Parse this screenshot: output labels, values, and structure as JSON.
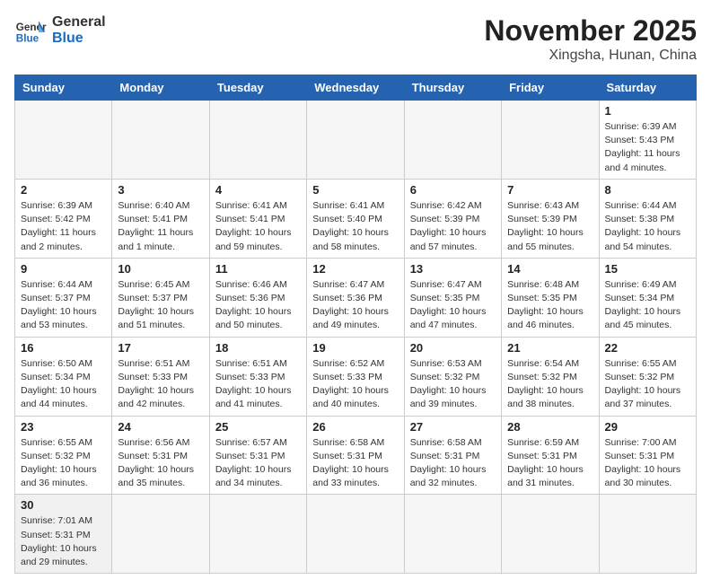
{
  "header": {
    "logo_line1": "General",
    "logo_line2": "Blue",
    "title": "November 2025",
    "subtitle": "Xingsha, Hunan, China"
  },
  "weekdays": [
    "Sunday",
    "Monday",
    "Tuesday",
    "Wednesday",
    "Thursday",
    "Friday",
    "Saturday"
  ],
  "weeks": [
    [
      {
        "day": "",
        "info": ""
      },
      {
        "day": "",
        "info": ""
      },
      {
        "day": "",
        "info": ""
      },
      {
        "day": "",
        "info": ""
      },
      {
        "day": "",
        "info": ""
      },
      {
        "day": "",
        "info": ""
      },
      {
        "day": "1",
        "info": "Sunrise: 6:39 AM\nSunset: 5:43 PM\nDaylight: 11 hours\nand 4 minutes."
      }
    ],
    [
      {
        "day": "2",
        "info": "Sunrise: 6:39 AM\nSunset: 5:42 PM\nDaylight: 11 hours\nand 2 minutes."
      },
      {
        "day": "3",
        "info": "Sunrise: 6:40 AM\nSunset: 5:41 PM\nDaylight: 11 hours\nand 1 minute."
      },
      {
        "day": "4",
        "info": "Sunrise: 6:41 AM\nSunset: 5:41 PM\nDaylight: 10 hours\nand 59 minutes."
      },
      {
        "day": "5",
        "info": "Sunrise: 6:41 AM\nSunset: 5:40 PM\nDaylight: 10 hours\nand 58 minutes."
      },
      {
        "day": "6",
        "info": "Sunrise: 6:42 AM\nSunset: 5:39 PM\nDaylight: 10 hours\nand 57 minutes."
      },
      {
        "day": "7",
        "info": "Sunrise: 6:43 AM\nSunset: 5:39 PM\nDaylight: 10 hours\nand 55 minutes."
      },
      {
        "day": "8",
        "info": "Sunrise: 6:44 AM\nSunset: 5:38 PM\nDaylight: 10 hours\nand 54 minutes."
      }
    ],
    [
      {
        "day": "9",
        "info": "Sunrise: 6:44 AM\nSunset: 5:37 PM\nDaylight: 10 hours\nand 53 minutes."
      },
      {
        "day": "10",
        "info": "Sunrise: 6:45 AM\nSunset: 5:37 PM\nDaylight: 10 hours\nand 51 minutes."
      },
      {
        "day": "11",
        "info": "Sunrise: 6:46 AM\nSunset: 5:36 PM\nDaylight: 10 hours\nand 50 minutes."
      },
      {
        "day": "12",
        "info": "Sunrise: 6:47 AM\nSunset: 5:36 PM\nDaylight: 10 hours\nand 49 minutes."
      },
      {
        "day": "13",
        "info": "Sunrise: 6:47 AM\nSunset: 5:35 PM\nDaylight: 10 hours\nand 47 minutes."
      },
      {
        "day": "14",
        "info": "Sunrise: 6:48 AM\nSunset: 5:35 PM\nDaylight: 10 hours\nand 46 minutes."
      },
      {
        "day": "15",
        "info": "Sunrise: 6:49 AM\nSunset: 5:34 PM\nDaylight: 10 hours\nand 45 minutes."
      }
    ],
    [
      {
        "day": "16",
        "info": "Sunrise: 6:50 AM\nSunset: 5:34 PM\nDaylight: 10 hours\nand 44 minutes."
      },
      {
        "day": "17",
        "info": "Sunrise: 6:51 AM\nSunset: 5:33 PM\nDaylight: 10 hours\nand 42 minutes."
      },
      {
        "day": "18",
        "info": "Sunrise: 6:51 AM\nSunset: 5:33 PM\nDaylight: 10 hours\nand 41 minutes."
      },
      {
        "day": "19",
        "info": "Sunrise: 6:52 AM\nSunset: 5:33 PM\nDaylight: 10 hours\nand 40 minutes."
      },
      {
        "day": "20",
        "info": "Sunrise: 6:53 AM\nSunset: 5:32 PM\nDaylight: 10 hours\nand 39 minutes."
      },
      {
        "day": "21",
        "info": "Sunrise: 6:54 AM\nSunset: 5:32 PM\nDaylight: 10 hours\nand 38 minutes."
      },
      {
        "day": "22",
        "info": "Sunrise: 6:55 AM\nSunset: 5:32 PM\nDaylight: 10 hours\nand 37 minutes."
      }
    ],
    [
      {
        "day": "23",
        "info": "Sunrise: 6:55 AM\nSunset: 5:32 PM\nDaylight: 10 hours\nand 36 minutes."
      },
      {
        "day": "24",
        "info": "Sunrise: 6:56 AM\nSunset: 5:31 PM\nDaylight: 10 hours\nand 35 minutes."
      },
      {
        "day": "25",
        "info": "Sunrise: 6:57 AM\nSunset: 5:31 PM\nDaylight: 10 hours\nand 34 minutes."
      },
      {
        "day": "26",
        "info": "Sunrise: 6:58 AM\nSunset: 5:31 PM\nDaylight: 10 hours\nand 33 minutes."
      },
      {
        "day": "27",
        "info": "Sunrise: 6:58 AM\nSunset: 5:31 PM\nDaylight: 10 hours\nand 32 minutes."
      },
      {
        "day": "28",
        "info": "Sunrise: 6:59 AM\nSunset: 5:31 PM\nDaylight: 10 hours\nand 31 minutes."
      },
      {
        "day": "29",
        "info": "Sunrise: 7:00 AM\nSunset: 5:31 PM\nDaylight: 10 hours\nand 30 minutes."
      }
    ],
    [
      {
        "day": "30",
        "info": "Sunrise: 7:01 AM\nSunset: 5:31 PM\nDaylight: 10 hours\nand 29 minutes."
      },
      {
        "day": "",
        "info": ""
      },
      {
        "day": "",
        "info": ""
      },
      {
        "day": "",
        "info": ""
      },
      {
        "day": "",
        "info": ""
      },
      {
        "day": "",
        "info": ""
      },
      {
        "day": "",
        "info": ""
      }
    ]
  ]
}
